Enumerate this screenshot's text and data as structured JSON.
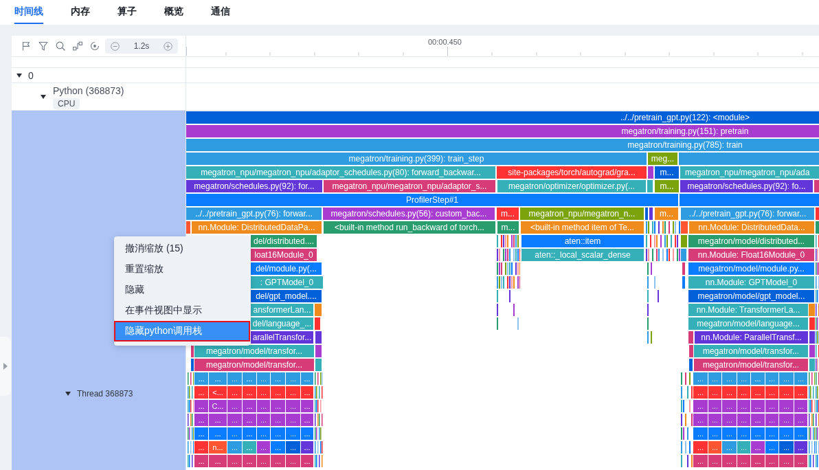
{
  "tabs": [
    {
      "label": "时间线",
      "selected": true
    },
    {
      "label": "内存",
      "selected": false
    },
    {
      "label": "算子",
      "selected": false
    },
    {
      "label": "概览",
      "selected": false
    },
    {
      "label": "通信",
      "selected": false
    }
  ],
  "toolbar": {
    "zoom_level": "1.2s"
  },
  "time_axis": {
    "label": "00:00.450"
  },
  "tree": [
    {
      "label": "0",
      "expanded": true,
      "children": [
        {
          "label": "Python (368873)",
          "tag": "CPU",
          "expanded": true,
          "children": [
            {
              "label": "Thread 368873",
              "expanded": true
            }
          ]
        }
      ]
    }
  ],
  "flame_rows": [
    {
      "blocks": [
        {
          "label": "../../pretrain_gpt.py(122): <module>",
          "color": "#0261d8"
        }
      ]
    },
    {
      "blocks": [
        {
          "label": "megatron/training.py(151): pretrain",
          "color": "#a83bd0"
        }
      ]
    },
    {
      "blocks": [
        {
          "label": "megatron/training.py(785): train",
          "color": "#2f9be0"
        }
      ]
    },
    {
      "blocks": [
        {
          "label": "megatron/training.py(399): train_step",
          "color": "#2f9be0"
        },
        {
          "label": "meg...",
          "color": "#7aa30c"
        },
        {
          "color": "#2f9be0"
        }
      ]
    },
    {
      "blocks": [
        {
          "label": "megatron_npu/megatron_npu/adaptor_schedules.py(80): forward_backwar...",
          "color": "#35b0b8"
        },
        {
          "label": "site-packages/torch/autograd/gra...",
          "color": "#ff3333"
        },
        {
          "color": "#a83bd0"
        },
        {
          "label": "m...",
          "color": "#0261d8"
        },
        {
          "label": "megatron_npu/megatron_npu/ada",
          "color": "#35b0b8"
        }
      ]
    },
    {
      "blocks": [
        {
          "label": "megatron/schedules.py(92): for...",
          "color": "#6236d9"
        },
        {
          "label": "megatron_npu/megatron_npu/adaptor_s...",
          "color": "#d63d78"
        },
        {
          "label": "megatron/optimizer/optimizer.py(...",
          "color": "#35b0b8"
        },
        {
          "color": "#35b0b8"
        },
        {
          "label": "m...",
          "color": "#7aa30c"
        },
        {
          "label": "megatron/schedules.py(92): fo...",
          "color": "#6236d9"
        },
        {
          "color": "#d63d78"
        }
      ]
    },
    {
      "blocks": [
        {
          "label": "ProfilerStep#1",
          "color": "#0a7cff"
        },
        {
          "color": "#0a7cff"
        }
      ]
    },
    {
      "blocks": [
        {
          "label": "../../pretrain_gpt.py(76): forwar...",
          "color": "#2f9be0"
        },
        {
          "label": "megatron/schedules.py(56): custom_bac...",
          "color": "#a83bd0"
        },
        {
          "label": "m...",
          "color": "#ff3333"
        },
        {
          "label": "megatron_npu/megatron_n...",
          "color": "#7aa30c"
        },
        {
          "color": "#0261d8"
        },
        {
          "color": "#6236d9"
        },
        {
          "label": "m...",
          "color": "#f08c1e"
        },
        {
          "label": "../../pretrain_gpt.py(76): forwar...",
          "color": "#2f9be0"
        },
        {
          "color": "#ff3333"
        }
      ]
    },
    {
      "blocks": [
        {
          "color": "#ff5533"
        },
        {
          "label": "nn.Module: DistributedDataPa...",
          "color": "#f08c1e"
        },
        {
          "label": "<built-in method run_backward of torch...",
          "color": "#2a9d6e"
        },
        {
          "label": "m...",
          "color": "#2a9d6e"
        },
        {
          "label": "<built-in method item of Te...",
          "color": "#f08c1e"
        },
        {
          "color": "#ff5533"
        },
        {
          "label": "nn.Module: DistributedData...",
          "color": "#f08c1e"
        },
        {
          "color": "#2a9d6e"
        }
      ]
    },
    {
      "blocks": [
        {
          "label": "del/distributed....",
          "color": "#2a9d6e"
        },
        {
          "label": "aten::item",
          "color": "#0a7cff"
        },
        {
          "color": "#7aa30c"
        },
        {
          "label": "megatron/model/distributed...",
          "color": "#2a9d6e"
        }
      ]
    },
    {
      "blocks": [
        {
          "label": "loat16Module_0",
          "color": "#d63d78"
        },
        {
          "label": "aten::_local_scalar_dense",
          "color": "#35b0b8"
        },
        {
          "color": "#2f9be0"
        },
        {
          "label": "nn.Module: Float16Module_0",
          "color": "#d63d78"
        }
      ]
    },
    {
      "blocks": [
        {
          "label": "del/module.py(...",
          "color": "#0a7cff"
        },
        {
          "color": "#d63d78"
        },
        {
          "label": "megatron/model/module.py...",
          "color": "#0a7cff"
        }
      ]
    },
    {
      "blocks": [
        {
          "label": ": GPTModel_0",
          "color": "#35b0b8"
        },
        {
          "color": "#0a7cff"
        },
        {
          "label": "nn.Module: GPTModel_0",
          "color": "#35b0b8"
        }
      ]
    },
    {
      "blocks": [
        {
          "label": "del/gpt_model....",
          "color": "#0261d8"
        },
        {
          "label": "megatron/model/gpt_model...",
          "color": "#0261d8"
        }
      ]
    },
    {
      "blocks": [
        {
          "label": "ansformerLan...",
          "color": "#35b0b8"
        },
        {
          "color": "#f08c1e"
        },
        {
          "label": "nn.Module: TransformerLa...",
          "color": "#35b0b8"
        },
        {
          "color": "#f08c1e"
        }
      ]
    },
    {
      "blocks": [
        {
          "label": "del/language_...",
          "color": "#35b0b8"
        },
        {
          "color": "#ff3333"
        },
        {
          "label": "megatron/model/language...",
          "color": "#35b0b8"
        },
        {
          "color": "#ff3333"
        }
      ]
    },
    {
      "blocks": [
        {
          "label": "arallelTransfor...",
          "color": "#6236d9"
        },
        {
          "color": "#6236d9"
        },
        {
          "color": "#d63d78"
        },
        {
          "label": "nn.Module: ParallelTransf...",
          "color": "#6236d9"
        },
        {
          "color": "#6236d9"
        }
      ]
    },
    {
      "blocks": [
        {
          "color": "#d63d78"
        },
        {
          "label": "megatron/model/transfor...",
          "color": "#35b0b8"
        },
        {
          "color": "#a83bd0"
        },
        {
          "color": "#d63d78"
        },
        {
          "label": "megatron/model/transfor...",
          "color": "#35b0b8"
        },
        {
          "color": "#a83bd0"
        }
      ]
    },
    {
      "blocks": [
        {
          "color": "#0261d8"
        },
        {
          "label": "megatron/model/transfor...",
          "color": "#d63d78"
        },
        {
          "color": "#35b0b8"
        },
        {
          "color": "#0261d8"
        },
        {
          "label": "megatron/model/transfor...",
          "color": "#d63d78"
        },
        {
          "color": "#35b0b8"
        }
      ]
    },
    {
      "blocks": [
        {
          "label": "...",
          "color": "#2f9be0"
        },
        {
          "label": "...",
          "color": "#2f9be0"
        },
        {
          "label": "...",
          "color": "#2f9be0"
        },
        {
          "label": "...",
          "color": "#2f9be0"
        },
        {
          "label": "...",
          "color": "#2f9be0"
        },
        {
          "label": "...",
          "color": "#2f9be0"
        },
        {
          "label": "...",
          "color": "#2f9be0"
        },
        {
          "label": "...",
          "color": "#2f9be0"
        },
        {
          "label": "...",
          "color": "#2f9be0"
        },
        {
          "label": "...",
          "color": "#2f9be0"
        },
        {
          "label": "...",
          "color": "#2f9be0"
        },
        {
          "label": "...",
          "color": "#2f9be0"
        },
        {
          "label": "...",
          "color": "#2f9be0"
        },
        {
          "label": "...",
          "color": "#2f9be0"
        },
        {
          "label": "...",
          "color": "#2f9be0"
        },
        {
          "label": "...",
          "color": "#2f9be0"
        }
      ]
    },
    {
      "blocks": [
        {
          "label": "...",
          "color": "#ff3333"
        },
        {
          "label": "<...",
          "color": "#ff3333"
        },
        {
          "label": "...",
          "color": "#ff3333"
        },
        {
          "label": "...",
          "color": "#ff3333"
        },
        {
          "label": "...",
          "color": "#ff3333"
        },
        {
          "label": "...",
          "color": "#ff3333"
        },
        {
          "label": "...",
          "color": "#ff3333"
        },
        {
          "label": "...",
          "color": "#ff3333"
        },
        {
          "label": "...",
          "color": "#ff3333"
        },
        {
          "label": "...",
          "color": "#ff3333"
        },
        {
          "label": "...",
          "color": "#ff3333"
        },
        {
          "label": "...",
          "color": "#ff3333"
        },
        {
          "label": "...",
          "color": "#ff3333"
        },
        {
          "label": "...",
          "color": "#ff3333"
        },
        {
          "label": "...",
          "color": "#ff3333"
        },
        {
          "label": "...",
          "color": "#ff3333"
        }
      ]
    },
    {
      "blocks": [
        {
          "label": "...",
          "color": "#a83bd0"
        },
        {
          "label": "C...",
          "color": "#a83bd0"
        },
        {
          "label": "...",
          "color": "#a83bd0"
        },
        {
          "label": "...",
          "color": "#a83bd0"
        },
        {
          "label": "...",
          "color": "#a83bd0"
        },
        {
          "label": "...",
          "color": "#a83bd0"
        },
        {
          "label": "...",
          "color": "#a83bd0"
        },
        {
          "label": "...",
          "color": "#a83bd0"
        },
        {
          "label": "...",
          "color": "#a83bd0"
        },
        {
          "label": "...",
          "color": "#a83bd0"
        },
        {
          "label": "...",
          "color": "#a83bd0"
        },
        {
          "label": "...",
          "color": "#a83bd0"
        },
        {
          "label": "...",
          "color": "#a83bd0"
        },
        {
          "label": "...",
          "color": "#a83bd0"
        },
        {
          "label": "...",
          "color": "#a83bd0"
        },
        {
          "label": "...",
          "color": "#a83bd0"
        }
      ]
    },
    {
      "blocks": [
        {
          "label": "...",
          "color": "#a83bd0"
        },
        {
          "label": "...",
          "color": "#a83bd0"
        },
        {
          "label": "...",
          "color": "#a83bd0"
        },
        {
          "label": "...",
          "color": "#a83bd0"
        },
        {
          "label": "...",
          "color": "#a83bd0"
        },
        {
          "label": "...",
          "color": "#a83bd0"
        },
        {
          "label": "...",
          "color": "#a83bd0"
        },
        {
          "label": "...",
          "color": "#a83bd0"
        },
        {
          "label": "...",
          "color": "#a83bd0"
        },
        {
          "label": "...",
          "color": "#a83bd0"
        },
        {
          "label": "...",
          "color": "#a83bd0"
        },
        {
          "label": "...",
          "color": "#a83bd0"
        },
        {
          "label": "...",
          "color": "#a83bd0"
        },
        {
          "label": "...",
          "color": "#a83bd0"
        },
        {
          "label": "...",
          "color": "#a83bd0"
        },
        {
          "label": "...",
          "color": "#a83bd0"
        }
      ]
    },
    {
      "blocks": [
        {
          "label": "...",
          "color": "#0a7cff"
        },
        {
          "label": "...",
          "color": "#0a7cff"
        },
        {
          "label": "...",
          "color": "#0a7cff"
        },
        {
          "label": "...",
          "color": "#0a7cff"
        },
        {
          "label": "...",
          "color": "#0a7cff"
        },
        {
          "label": "...",
          "color": "#0a7cff"
        },
        {
          "label": "...",
          "color": "#0a7cff"
        },
        {
          "label": "...",
          "color": "#0a7cff"
        },
        {
          "label": "...",
          "color": "#0a7cff"
        },
        {
          "label": "...",
          "color": "#0a7cff"
        },
        {
          "label": "...",
          "color": "#0a7cff"
        },
        {
          "label": "...",
          "color": "#0a7cff"
        },
        {
          "label": "...",
          "color": "#0a7cff"
        },
        {
          "label": "...",
          "color": "#0a7cff"
        },
        {
          "label": "...",
          "color": "#0a7cff"
        },
        {
          "label": "...",
          "color": "#0a7cff"
        }
      ]
    },
    {
      "blocks": [
        {
          "label": "...",
          "color": "#ff3333"
        },
        {
          "label": "n...",
          "color": "#ff5533"
        },
        {
          "label": "...",
          "color": "#2f9be0"
        },
        {
          "label": "...",
          "color": "#35b0b8"
        },
        {
          "label": "...",
          "color": "#a83bd0"
        },
        {
          "label": "...",
          "color": "#0a7cff"
        },
        {
          "label": "...",
          "color": "#0261d8"
        },
        {
          "label": "...",
          "color": "#6236d9"
        },
        {
          "label": "...",
          "color": "#ff3333"
        },
        {
          "label": "...",
          "color": "#ff5533"
        },
        {
          "label": "...",
          "color": "#2f9be0"
        },
        {
          "label": "...",
          "color": "#35b0b8"
        },
        {
          "label": "...",
          "color": "#a83bd0"
        },
        {
          "label": "...",
          "color": "#0a7cff"
        },
        {
          "label": "...",
          "color": "#0261d8"
        },
        {
          "label": "...",
          "color": "#6236d9"
        }
      ]
    },
    {
      "blocks": [
        {
          "label": "...",
          "color": "#d63d78"
        },
        {
          "label": "...",
          "color": "#d63d78"
        },
        {
          "label": "...",
          "color": "#d63d78"
        },
        {
          "label": "...",
          "color": "#d63d78"
        },
        {
          "label": "...",
          "color": "#d63d78"
        },
        {
          "label": "...",
          "color": "#d63d78"
        },
        {
          "label": "...",
          "color": "#d63d78"
        },
        {
          "label": "...",
          "color": "#d63d78"
        },
        {
          "label": "...",
          "color": "#d63d78"
        },
        {
          "label": "...",
          "color": "#d63d78"
        },
        {
          "label": "...",
          "color": "#d63d78"
        },
        {
          "label": "...",
          "color": "#d63d78"
        },
        {
          "label": "...",
          "color": "#d63d78"
        },
        {
          "label": "...",
          "color": "#d63d78"
        },
        {
          "label": "...",
          "color": "#d63d78"
        },
        {
          "label": "...",
          "color": "#d63d78"
        }
      ]
    }
  ],
  "context_menu": [
    {
      "label": "撤消缩放 (15)",
      "selected": false
    },
    {
      "label": "重置缩放",
      "selected": false
    },
    {
      "label": "隐藏",
      "selected": false
    },
    {
      "label": "在事件视图中显示",
      "selected": false
    },
    {
      "label": "隐藏python调用栈",
      "selected": true
    }
  ]
}
